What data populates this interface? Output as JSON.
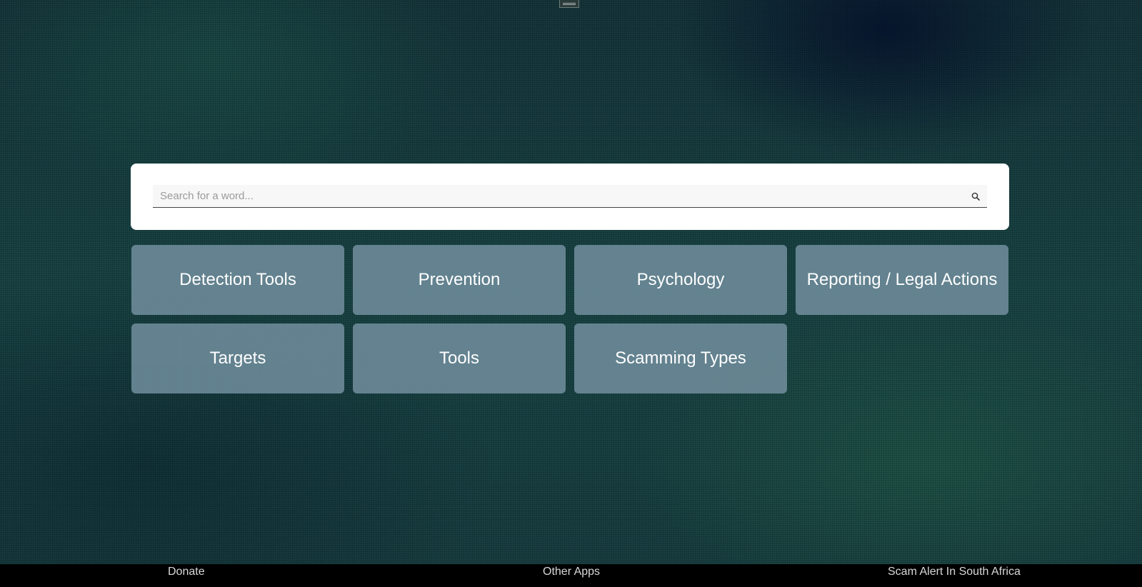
{
  "search": {
    "placeholder": "Search for a word..."
  },
  "categories": [
    {
      "label": "Detection Tools"
    },
    {
      "label": "Prevention"
    },
    {
      "label": "Psychology"
    },
    {
      "label": "Reporting / Legal Actions"
    },
    {
      "label": "Targets"
    },
    {
      "label": "Tools"
    },
    {
      "label": "Scamming Types"
    }
  ],
  "footer": {
    "donate": "Donate",
    "other_apps": "Other Apps",
    "site": "Scam Alert In South Africa"
  },
  "icons": {
    "search": "search-icon",
    "menu": "menu-icon"
  },
  "colors": {
    "tile": "#6e8c9b",
    "footer_bg": "#000000",
    "card_bg": "#ffffff"
  }
}
